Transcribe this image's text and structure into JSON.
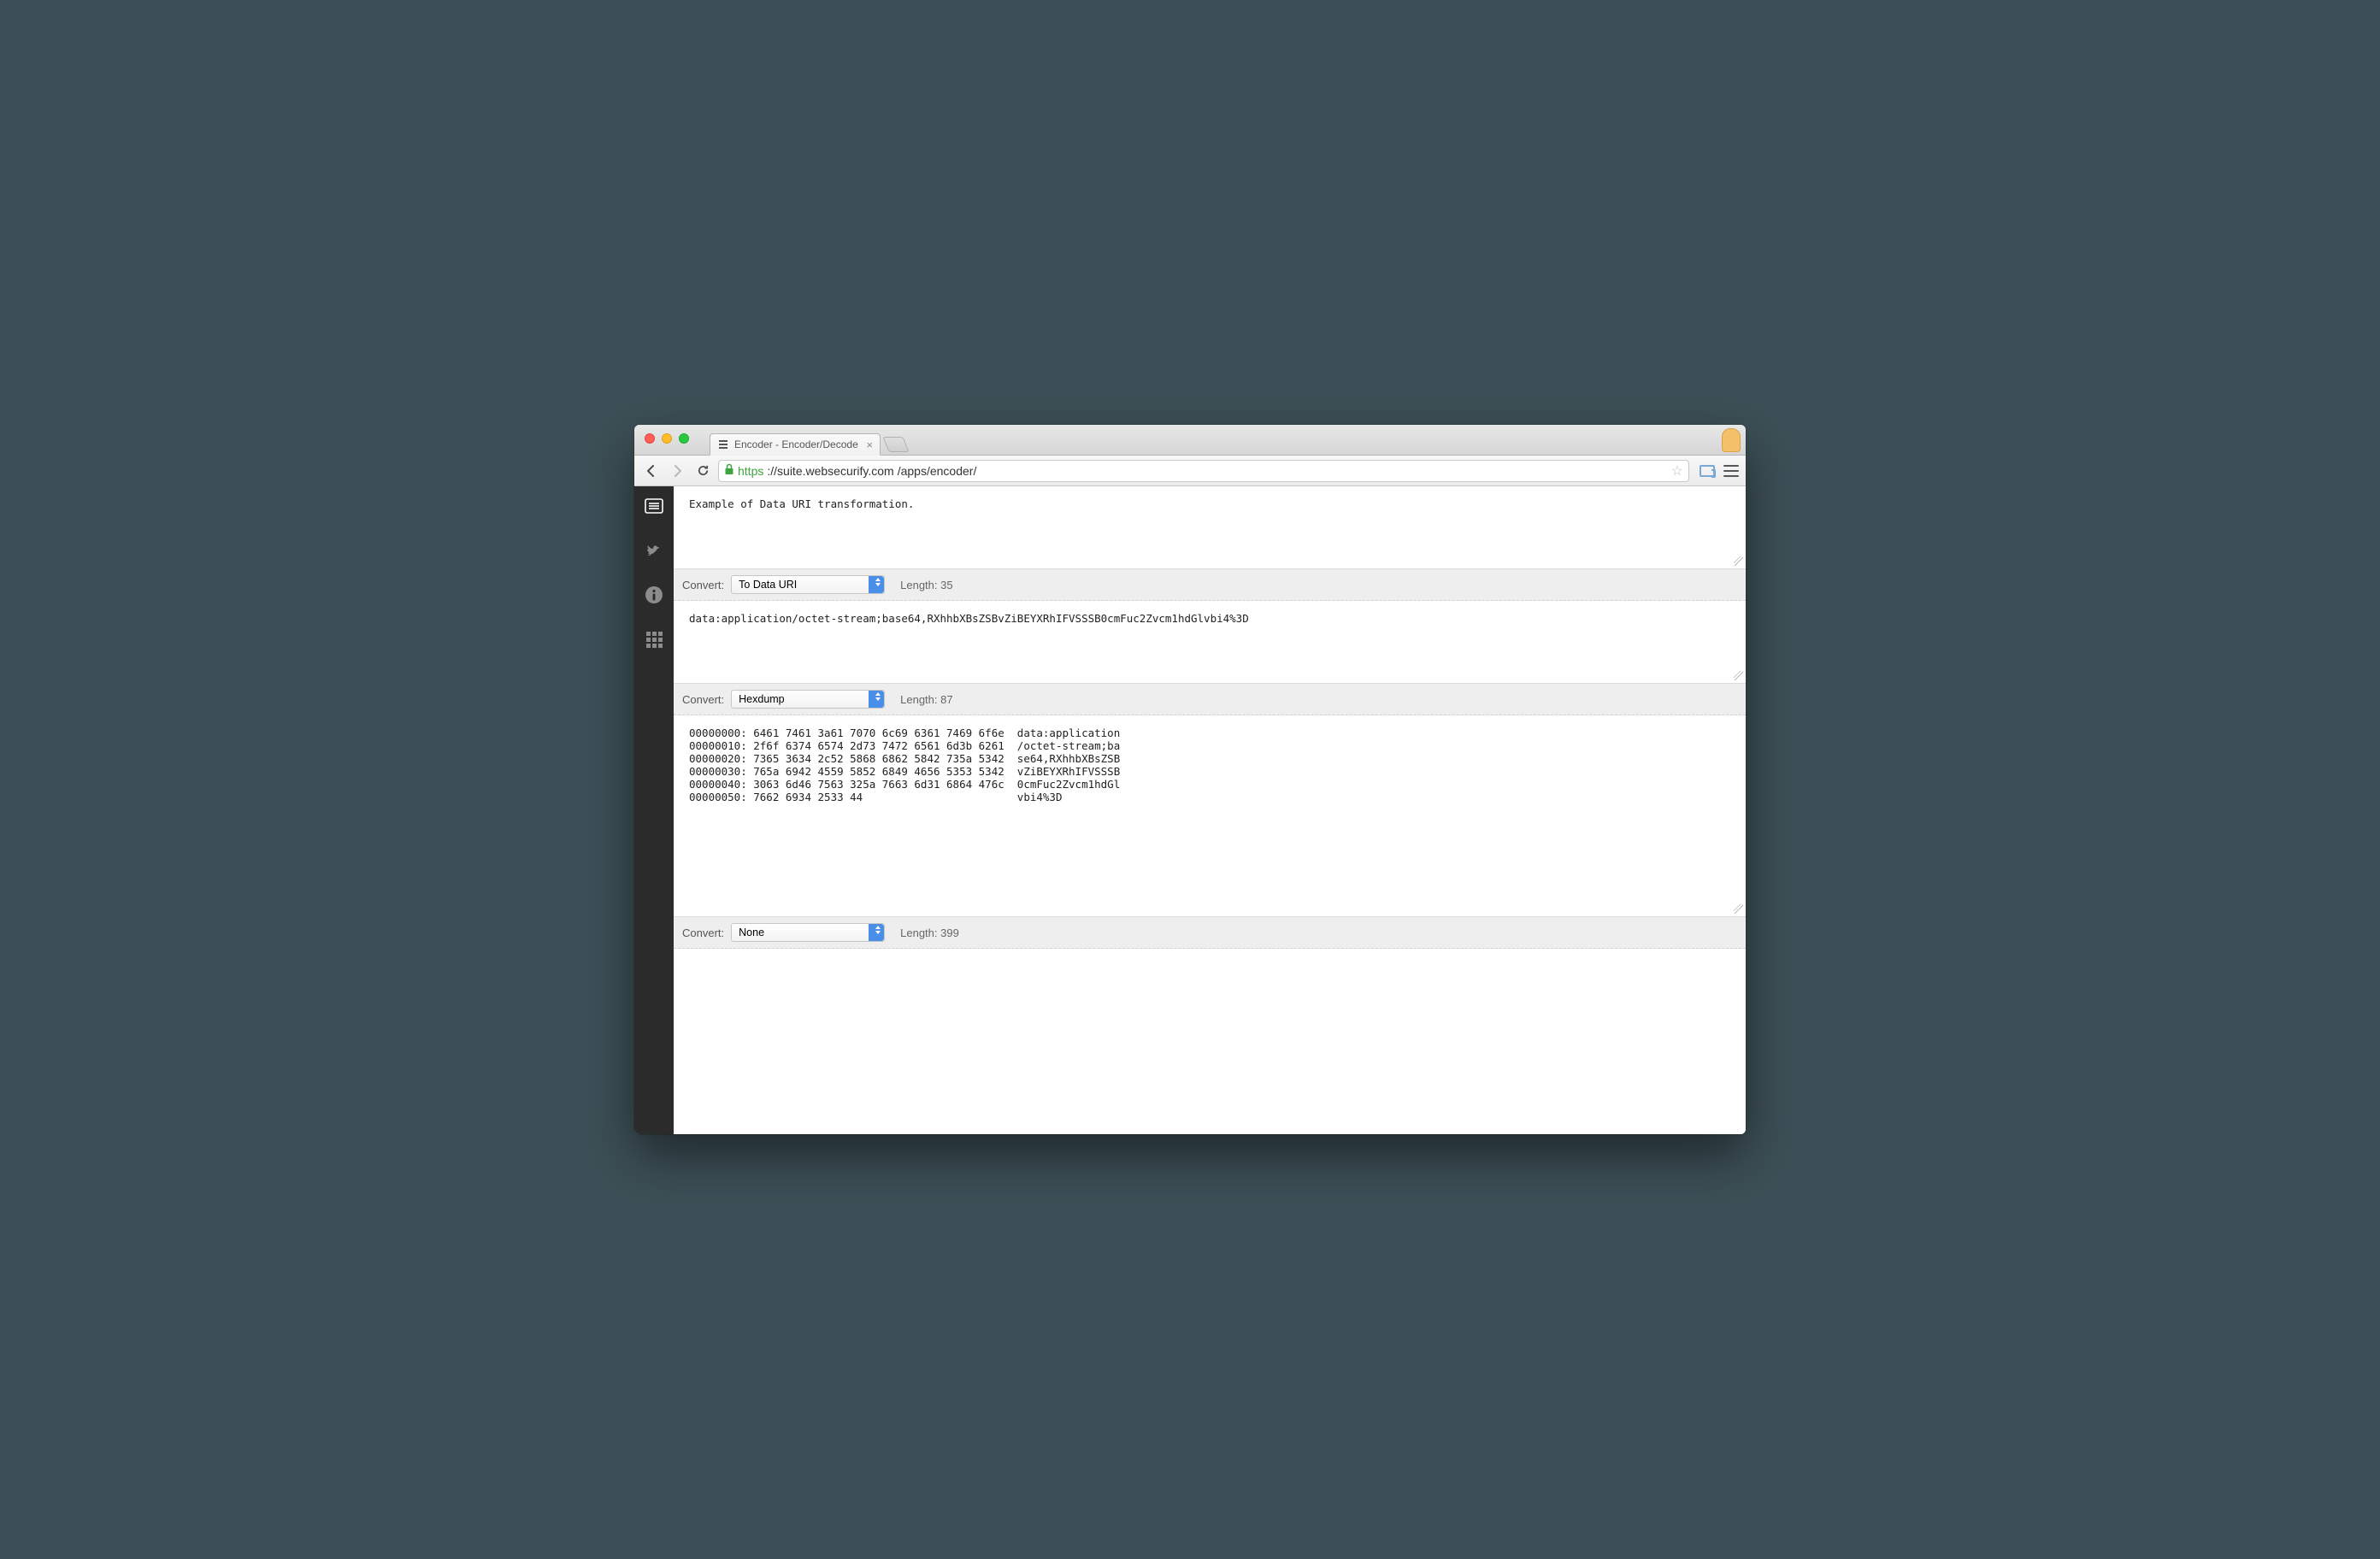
{
  "browser": {
    "tab_title": "Encoder - Encoder/Decode",
    "url_scheme": "https",
    "url_host": "://suite.websecurify.com",
    "url_path": "/apps/encoder/"
  },
  "panes": [
    {
      "text": "Example of Data URI transformation.",
      "convert_label": "Convert:",
      "convert_value": "To Data URI",
      "length_label": "Length:",
      "length_value": "35"
    },
    {
      "text": "data:application/octet-stream;base64,RXhhbXBsZSBvZiBEYXRhIFVSSSB0cmFuc2Zvcm1hdGlvbi4%3D",
      "convert_label": "Convert:",
      "convert_value": "Hexdump",
      "length_label": "Length:",
      "length_value": "87"
    },
    {
      "text": "00000000: 6461 7461 3a61 7070 6c69 6361 7469 6f6e  data:application\n00000010: 2f6f 6374 6574 2d73 7472 6561 6d3b 6261  /octet-stream;ba\n00000020: 7365 3634 2c52 5868 6862 5842 735a 5342  se64,RXhhbXBsZSB\n00000030: 765a 6942 4559 5852 6849 4656 5353 5342  vZiBEYXRhIFVSSSB\n00000040: 3063 6d46 7563 325a 7663 6d31 6864 476c  0cmFuc2Zvcm1hdGl\n00000050: 7662 6934 2533 44                        vbi4%3D",
      "convert_label": "Convert:",
      "convert_value": "None",
      "length_label": "Length:",
      "length_value": "399"
    }
  ]
}
